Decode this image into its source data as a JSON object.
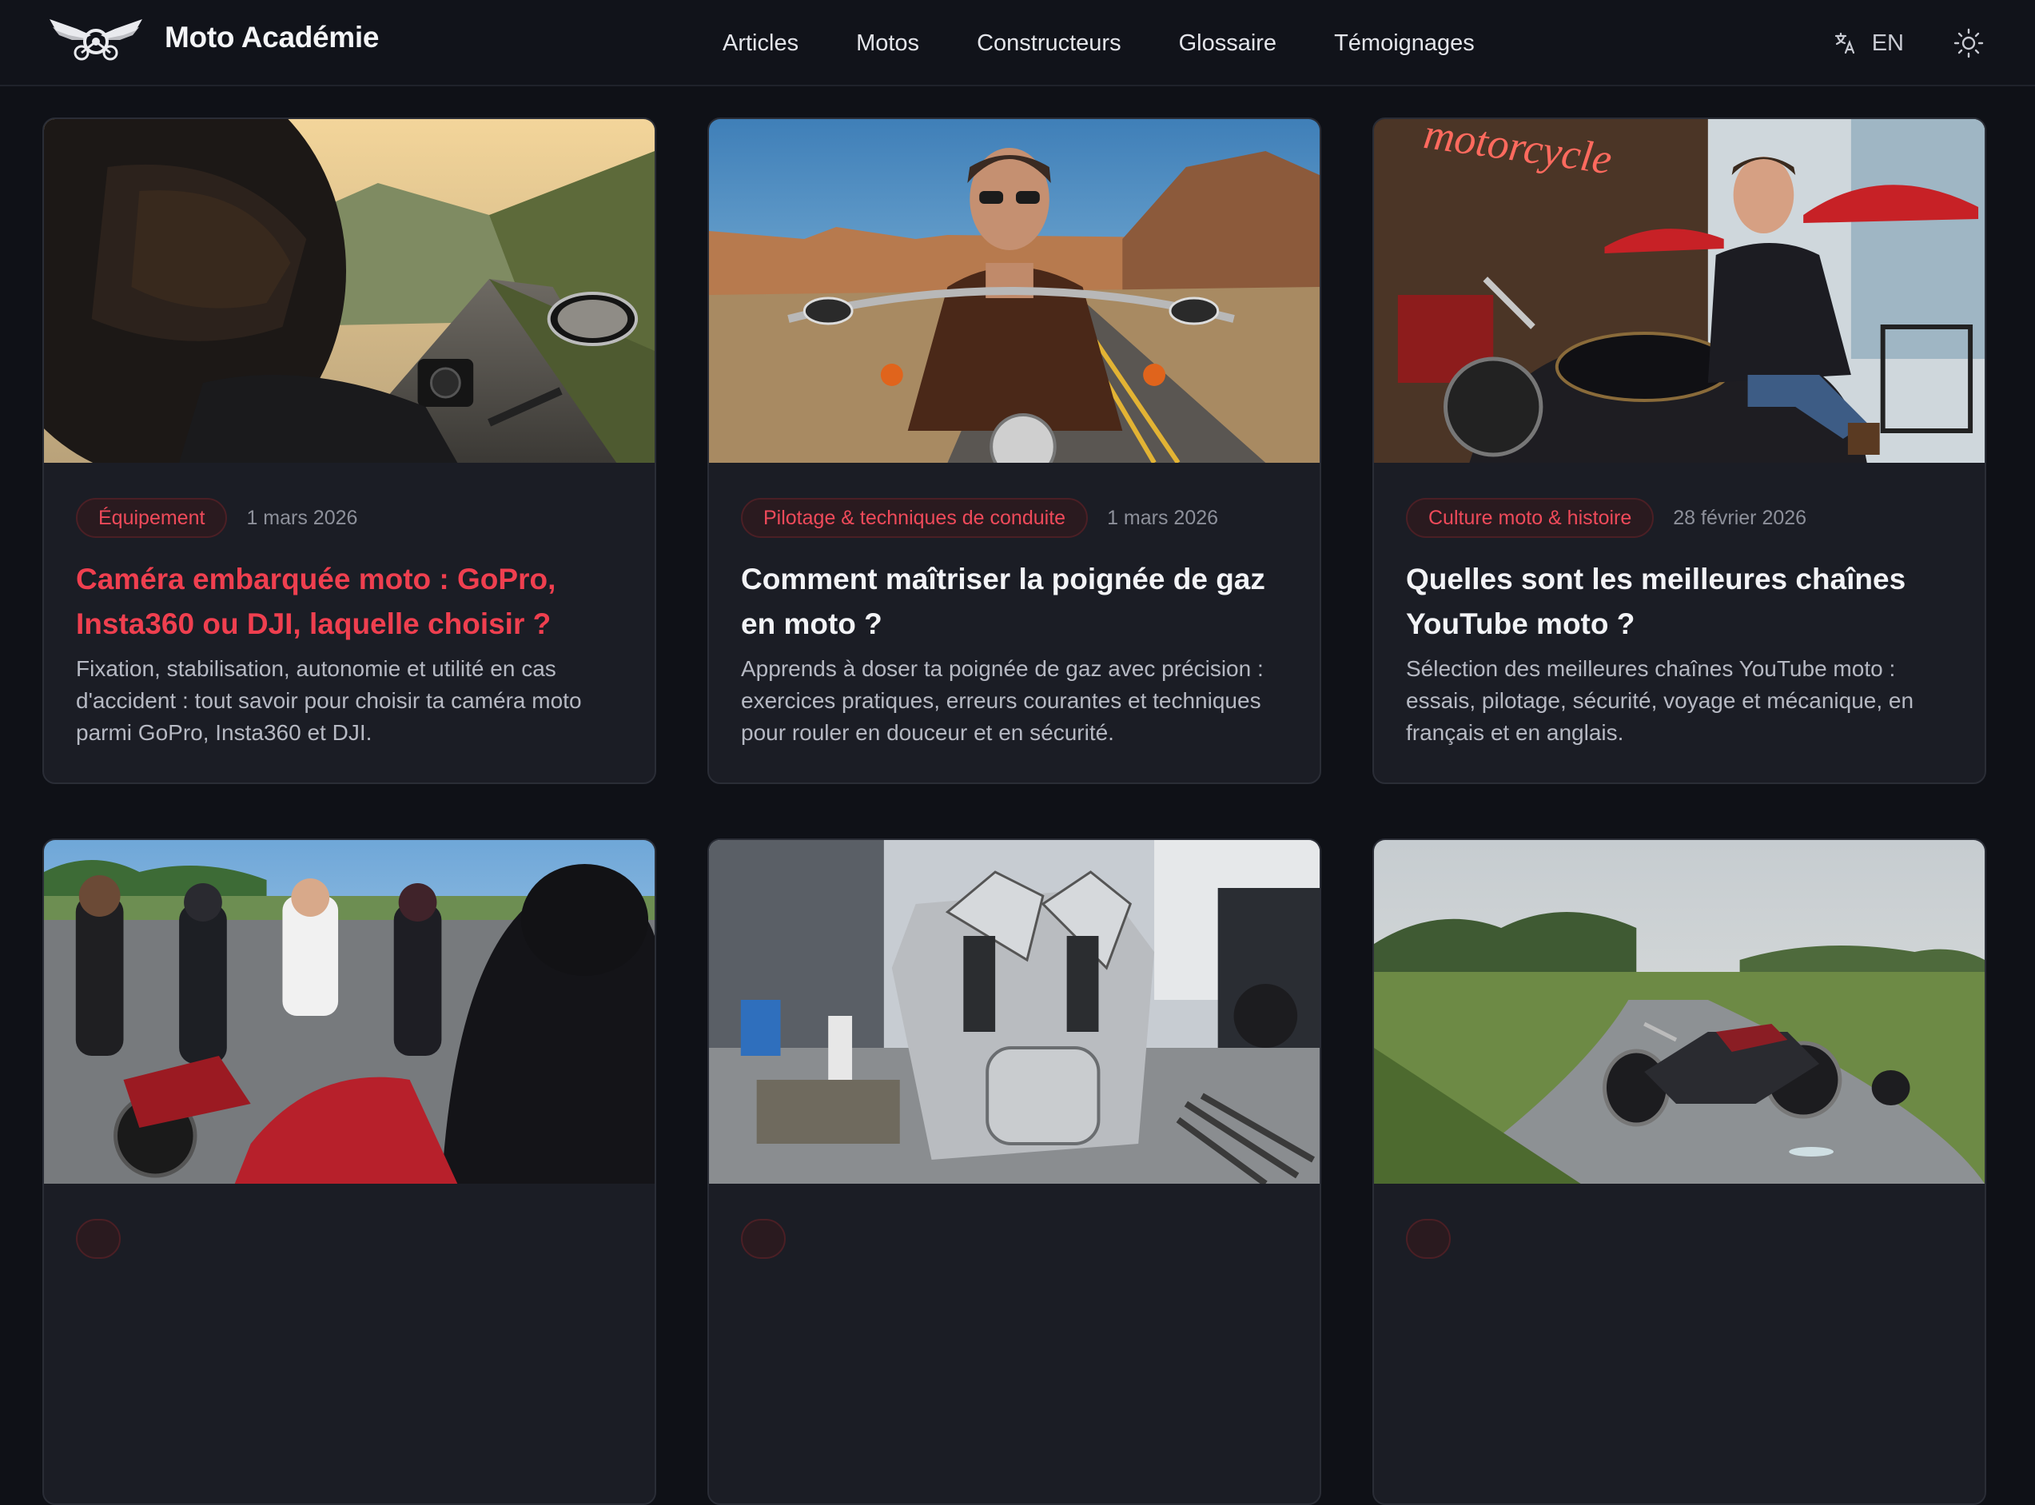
{
  "header": {
    "brand": "Moto Académie",
    "nav": [
      "Articles",
      "Motos",
      "Constructeurs",
      "Glossaire",
      "Témoignages"
    ],
    "lang": "EN",
    "lang_icon": "translate-icon",
    "theme_icon": "sun-icon"
  },
  "colors": {
    "background": "#0f1117",
    "card": "#1b1d25",
    "accent": "#ef3f4f"
  },
  "cards": [
    {
      "category": "Équipement",
      "date": "1 mars 2026",
      "title": "Caméra embarquée moto : GoPro, Insta360 ou DJI, laquelle choisir ?",
      "excerpt": "Fixation, stabilisation, autonomie et utilité en cas d'accident : tout savoir pour choisir ta caméra moto parmi GoPro, Insta360 et DJI."
    },
    {
      "category": "Pilotage & techniques de conduite",
      "date": "1 mars 2026",
      "title": "Comment maîtriser la poignée de gaz en moto ?",
      "excerpt": "Apprends à doser ta poignée de gaz avec précision : exercices pratiques, erreurs courantes et techniques pour rouler en douceur et en sécurité."
    },
    {
      "category": "Culture moto & histoire",
      "date": "28 février 2026",
      "title": "Quelles sont les meilleures chaînes YouTube moto ?",
      "excerpt": "Sélection des meilleures chaînes YouTube moto : essais, pilotage, sécurité, voyage et mécanique, en français et en anglais.",
      "neon_sign": "motorcycle"
    },
    {
      "category": "",
      "date": "",
      "title": "",
      "excerpt": ""
    },
    {
      "category": "",
      "date": "",
      "title": "",
      "excerpt": ""
    },
    {
      "category": "",
      "date": "",
      "title": "",
      "excerpt": ""
    }
  ]
}
